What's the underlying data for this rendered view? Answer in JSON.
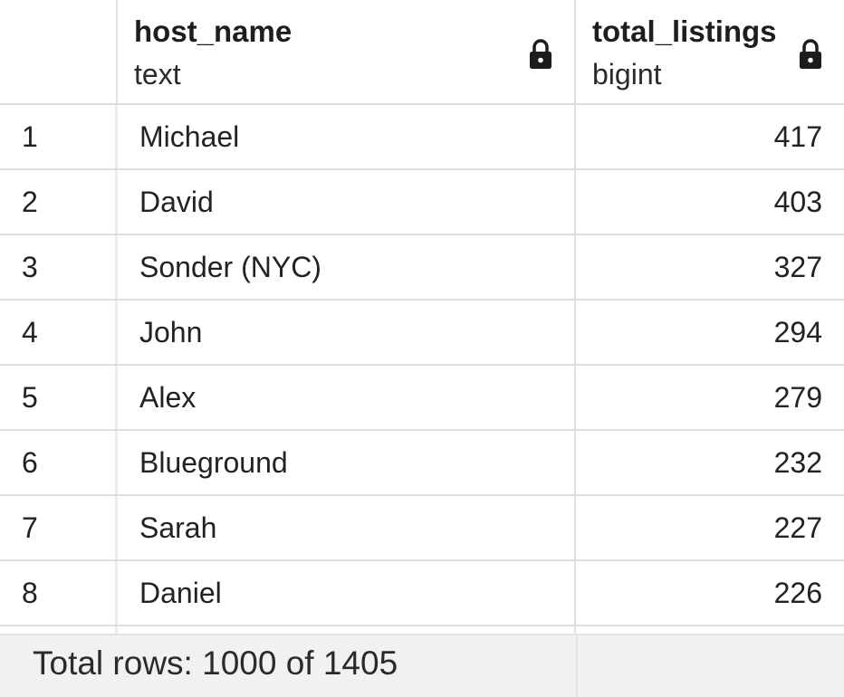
{
  "columns": [
    {
      "name": "host_name",
      "type": "text",
      "icon": "lock-icon"
    },
    {
      "name": "total_listings",
      "type": "bigint",
      "icon": "lock-icon"
    }
  ],
  "rows": [
    {
      "index": "1",
      "host_name": "Michael",
      "total_listings": "417"
    },
    {
      "index": "2",
      "host_name": "David",
      "total_listings": "403"
    },
    {
      "index": "3",
      "host_name": "Sonder (NYC)",
      "total_listings": "327"
    },
    {
      "index": "4",
      "host_name": "John",
      "total_listings": "294"
    },
    {
      "index": "5",
      "host_name": "Alex",
      "total_listings": "279"
    },
    {
      "index": "6",
      "host_name": "Blueground",
      "total_listings": "232"
    },
    {
      "index": "7",
      "host_name": "Sarah",
      "total_listings": "227"
    },
    {
      "index": "8",
      "host_name": "Daniel",
      "total_listings": "226"
    }
  ],
  "footer": {
    "status_text": "Total rows: 1000 of 1405"
  },
  "colors": {
    "grid_line": "#dedede",
    "footer_bg": "#f0f1f2",
    "text": "#222222"
  }
}
